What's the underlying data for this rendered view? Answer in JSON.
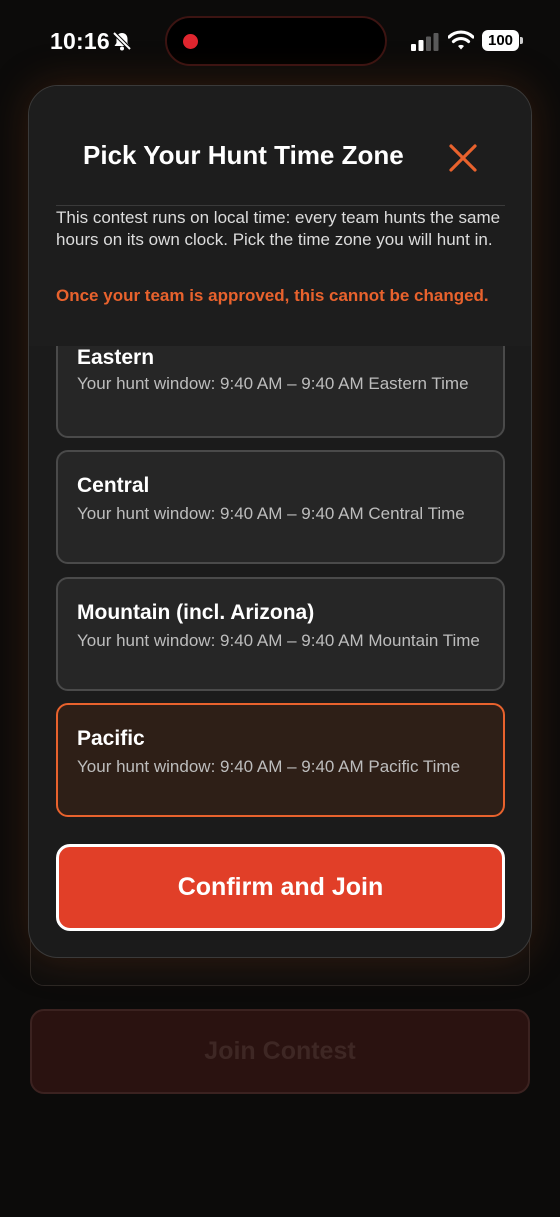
{
  "status_bar": {
    "time": "10:16",
    "battery": "100",
    "icons": [
      "bell-slash-icon",
      "cellular-signal-icon",
      "wifi-icon",
      "battery-icon"
    ]
  },
  "modal": {
    "title": "Pick Your Hunt Time Zone",
    "close_icon": "close-icon",
    "description": "This contest runs on local time: every team hunts the same hours on its own clock. Pick the time zone you will hunt in.",
    "warning": "Once your team is approved, this cannot be changed.",
    "options": [
      {
        "name": "Eastern",
        "detail": "Your hunt window: 9:40 AM – 9:40 AM Eastern Time",
        "selected": false
      },
      {
        "name": "Central",
        "detail": "Your hunt window: 9:40 AM – 9:40 AM Central Time",
        "selected": false
      },
      {
        "name": "Mountain (incl. Arizona)",
        "detail": "Your hunt window: 9:40 AM – 9:40 AM Mountain Time",
        "selected": false
      },
      {
        "name": "Pacific",
        "detail": "Your hunt window: 9:40 AM – 9:40 AM Pacific Time",
        "selected": true
      }
    ],
    "confirm_label": "Confirm and Join"
  },
  "background": {
    "join_label": "Join Contest"
  },
  "colors": {
    "accent": "#e8622d",
    "confirm": "#e13f28",
    "selected_bg": "#2e1f17",
    "modal_bg": "#1b1b1b"
  }
}
